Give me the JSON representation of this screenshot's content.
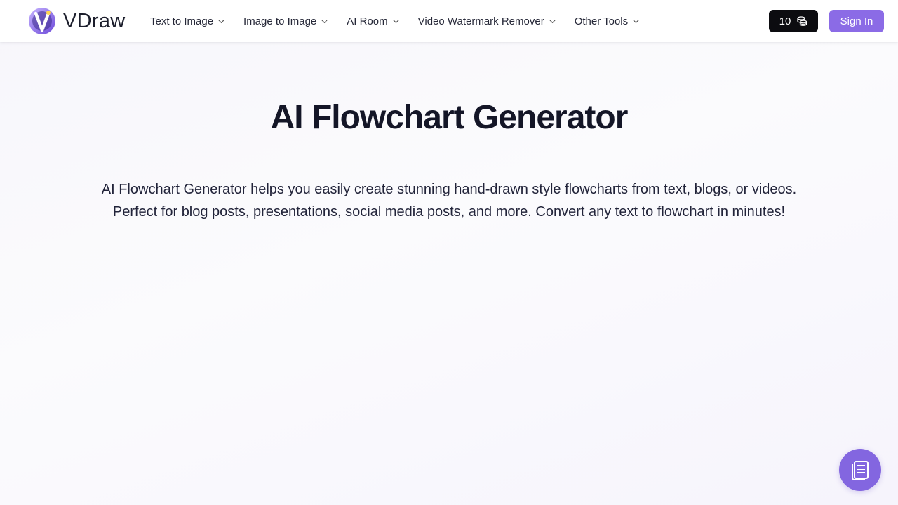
{
  "brand": {
    "name": "VDraw",
    "logo_icon": "vdraw-logo-icon",
    "accent": "#8b6be6"
  },
  "nav": {
    "items": [
      {
        "label": "Text to Image",
        "icon": "chevron-down-icon"
      },
      {
        "label": "Image to Image",
        "icon": "chevron-down-icon"
      },
      {
        "label": "AI Room",
        "icon": "chevron-down-icon"
      },
      {
        "label": "Video Watermark Remover",
        "icon": "chevron-down-icon"
      },
      {
        "label": "Other Tools",
        "icon": "chevron-down-icon"
      }
    ]
  },
  "header": {
    "credits": {
      "value": "10",
      "icon": "coins-icon",
      "bg": "#0c0c10"
    },
    "sign_in_label": "Sign In"
  },
  "hero": {
    "title": "AI Flowchart Generator",
    "description_line1": "AI Flowchart Generator helps you easily create stunning hand-drawn style flowcharts from text, blogs, or videos.",
    "description_line2": "Perfect for blog posts, presentations, social media posts, and more. Convert any text to flowchart in minutes!"
  },
  "floating_button": {
    "icon": "document-list-icon",
    "color": "#8366e0"
  }
}
